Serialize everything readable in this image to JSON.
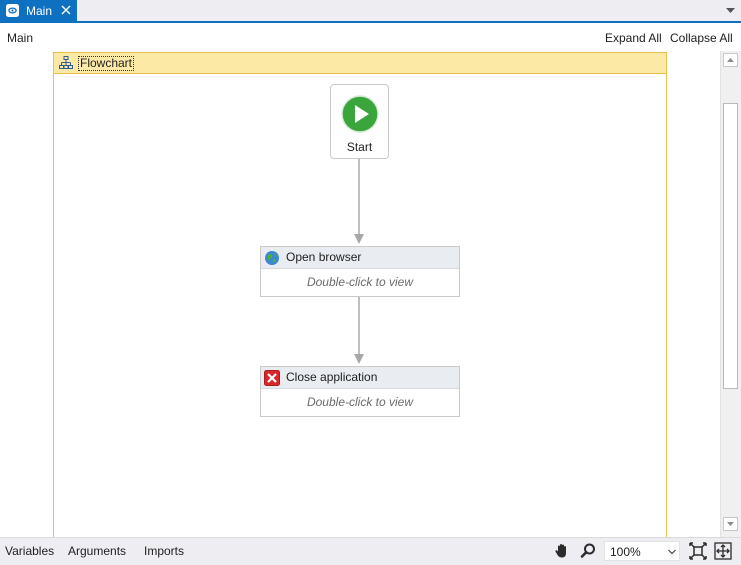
{
  "tab": {
    "label": "Main",
    "icon": "workflow-document-icon"
  },
  "header": {
    "breadcrumb": "Main",
    "expand_all": "Expand All",
    "collapse_all": "Collapse All"
  },
  "flowchart": {
    "title": "Flowchart",
    "start": {
      "label": "Start"
    },
    "activities": [
      {
        "title": "Open browser",
        "hint": "Double-click to view",
        "icon": "globe-icon"
      },
      {
        "title": "Close application",
        "hint": "Double-click to view",
        "icon": "red-x-icon"
      }
    ]
  },
  "bottom": {
    "tabs": [
      "Variables",
      "Arguments",
      "Imports"
    ],
    "zoom": "100%"
  },
  "colors": {
    "accent": "#0e70c0",
    "flowchart_header": "#fde9a6",
    "flowchart_border": "#e8c24a",
    "start_green": "#3aa53a",
    "close_red": "#d9262a"
  }
}
